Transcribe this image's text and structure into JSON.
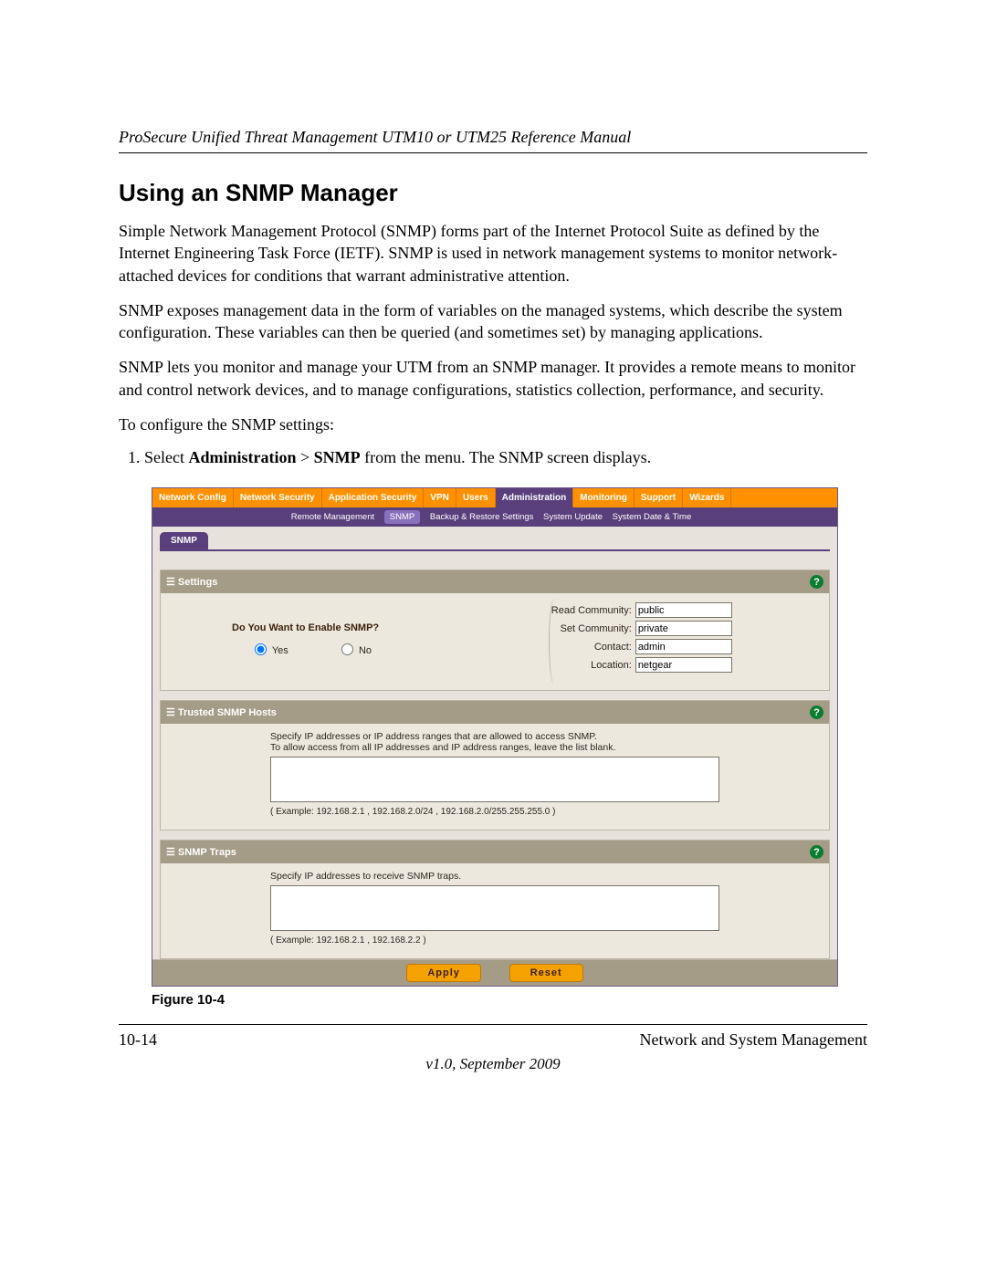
{
  "header": {
    "running": "ProSecure Unified Threat Management UTM10 or UTM25 Reference Manual"
  },
  "section_title": "Using an SNMP Manager",
  "paragraphs": {
    "p1": "Simple Network Management Protocol (SNMP) forms part of the Internet Protocol Suite as defined by the Internet Engineering Task Force (IETF). SNMP is used in network management systems to monitor network-attached devices for conditions that warrant administrative attention.",
    "p2": "SNMP exposes management data in the form of variables on the managed systems, which describe the system configuration. These variables can then be queried (and sometimes set) by managing applications.",
    "p3": "SNMP lets you monitor and manage your UTM from an SNMP manager. It provides a remote means to monitor and control network devices, and to manage configurations, statistics collection, performance, and security.",
    "p4": "To configure the SNMP settings:"
  },
  "step1": {
    "prefix": "Select ",
    "bold1": "Administration",
    "gt": " > ",
    "bold2": "SNMP",
    "suffix": " from the menu. The SNMP screen displays."
  },
  "screenshot": {
    "nav": {
      "t1": "Network Config",
      "t2": "Network Security",
      "t3": "Application Security",
      "t4": "VPN",
      "t5": "Users",
      "t6": "Administration",
      "t7": "Monitoring",
      "t8": "Support",
      "t9": "Wizards"
    },
    "subnav": {
      "s1": "Remote Management",
      "s2": "SNMP",
      "s3": "Backup & Restore Settings",
      "s4": "System Update",
      "s5": "System Date & Time"
    },
    "tab": "SNMP",
    "settings": {
      "title": "Settings",
      "question": "Do You Want to Enable SNMP?",
      "yes": "Yes",
      "no": "No",
      "read_label": "Read Community:",
      "read_value": "public",
      "set_label": "Set Community:",
      "set_value": "private",
      "contact_label": "Contact:",
      "contact_value": "admin",
      "location_label": "Location:",
      "location_value": "netgear"
    },
    "trusted": {
      "title": "Trusted SNMP Hosts",
      "line1": "Specify IP addresses or IP address ranges that are allowed to access SNMP.",
      "line2": "To allow access from all IP addresses and IP address ranges, leave the list blank.",
      "example": "( Example: 192.168.2.1 , 192.168.2.0/24 , 192.168.2.0/255.255.255.0 )"
    },
    "traps": {
      "title": "SNMP Traps",
      "line1": "Specify IP addresses to receive SNMP traps.",
      "example": "( Example: 192.168.2.1 , 192.168.2.2 )"
    },
    "buttons": {
      "apply": "Apply",
      "reset": "Reset"
    }
  },
  "figure_label": "Figure 10-4",
  "footer": {
    "page": "10-14",
    "chapter": "Network and System Management",
    "version": "v1.0, September 2009"
  }
}
